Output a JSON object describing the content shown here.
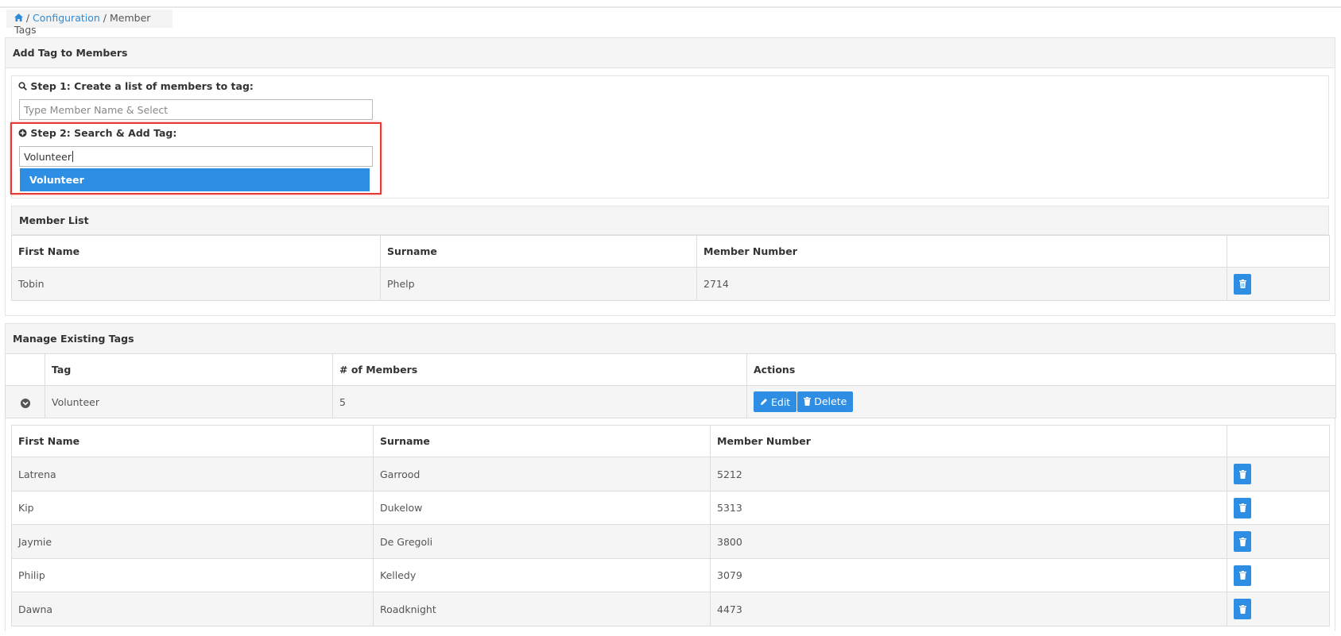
{
  "breadcrumb": {
    "home_icon": "home-icon",
    "sep1": "/",
    "configuration": "Configuration",
    "sep2": "/",
    "current": "Member Tags"
  },
  "add_panel": {
    "title": "Add Tag to Members",
    "step1": {
      "icon": "search-icon",
      "label": "Step 1: Create a list of members to tag:",
      "placeholder": "Type Member Name & Select",
      "value": ""
    },
    "step2": {
      "icon": "plus-circle-icon",
      "label": "Step 2: Search & Add Tag:",
      "value": "Volunteer",
      "suggestion": "Volunteer"
    },
    "member_list": {
      "title": "Member List",
      "columns": [
        "First Name",
        "Surname",
        "Member Number",
        ""
      ],
      "rows": [
        {
          "first": "Tobin",
          "surname": "Phelp",
          "number": "2714"
        }
      ]
    }
  },
  "manage_panel": {
    "title": "Manage Existing Tags",
    "columns": [
      "",
      "Tag",
      "# of Members",
      "Actions"
    ],
    "tags": [
      {
        "tag": "Volunteer",
        "members": "5",
        "edit_label": "Edit",
        "delete_label": "Delete"
      }
    ],
    "sub_columns": [
      "First Name",
      "Surname",
      "Member Number",
      ""
    ],
    "sub_rows": [
      {
        "first": "Latrena",
        "surname": "Garrood",
        "number": "5212"
      },
      {
        "first": "Kip",
        "surname": "Dukelow",
        "number": "5313"
      },
      {
        "first": "Jaymie",
        "surname": "De Gregoli",
        "number": "3800"
      },
      {
        "first": "Philip",
        "surname": "Kelledy",
        "number": "3079"
      },
      {
        "first": "Dawna",
        "surname": "Roadknight",
        "number": "4473"
      }
    ]
  },
  "colors": {
    "accent": "#2d8ee3",
    "highlight": "#e53935",
    "link": "#2f8ad8"
  }
}
